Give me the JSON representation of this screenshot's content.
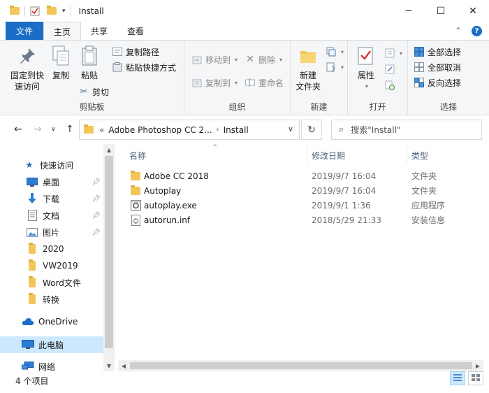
{
  "window": {
    "title": "Install",
    "minimize_glyph": "─",
    "maximize_glyph": "☐",
    "close_glyph": "✕"
  },
  "tabs": [
    {
      "label": "文件",
      "kind": "file"
    },
    {
      "label": "主页",
      "kind": "active"
    },
    {
      "label": "共享",
      "kind": ""
    },
    {
      "label": "查看",
      "kind": ""
    }
  ],
  "ribbon": {
    "clipboard": {
      "label": "剪贴板",
      "pin": "固定到快\n速访问",
      "copy": "复制",
      "paste": "粘贴",
      "copy_path": "复制路径",
      "paste_shortcut": "粘贴快捷方式",
      "cut": "剪切"
    },
    "organize": {
      "label": "组织",
      "move_to": "移动到",
      "copy_to": "复制到",
      "delete": "删除",
      "rename": "重命名"
    },
    "new": {
      "label": "新建",
      "new_folder": "新建\n文件夹"
    },
    "open": {
      "label": "打开",
      "properties": "属性"
    },
    "select": {
      "label": "选择",
      "select_all": "全部选择",
      "select_none": "全部取消",
      "invert": "反向选择"
    }
  },
  "address": {
    "prefix": "«",
    "segments": [
      "Adobe Photoshop CC 2...",
      "Install"
    ],
    "search_placeholder": "搜索\"Install\""
  },
  "nav": {
    "quick_access": "快速访问",
    "items": [
      {
        "label": "桌面",
        "icon": "desktop-icon",
        "pinned": true
      },
      {
        "label": "下载",
        "icon": "download-icon",
        "pinned": true
      },
      {
        "label": "文档",
        "icon": "document-icon",
        "pinned": true
      },
      {
        "label": "图片",
        "icon": "picture-icon",
        "pinned": true
      },
      {
        "label": "2020",
        "icon": "folder-icon",
        "pinned": false
      },
      {
        "label": "VW2019",
        "icon": "folder-icon",
        "pinned": false
      },
      {
        "label": "Word文件",
        "icon": "folder-icon",
        "pinned": false
      },
      {
        "label": "转换",
        "icon": "folder-icon",
        "pinned": false
      }
    ],
    "onedrive": "OneDrive",
    "this_pc": "此电脑",
    "network": "网络"
  },
  "list": {
    "columns": {
      "name": "名称",
      "modified": "修改日期",
      "type": "类型"
    },
    "files": [
      {
        "name": "Adobe CC 2018",
        "modified": "2019/9/7 16:04",
        "type": "文件夹",
        "icon": "folder-icon"
      },
      {
        "name": "Autoplay",
        "modified": "2019/9/7 16:04",
        "type": "文件夹",
        "icon": "folder-icon"
      },
      {
        "name": "autoplay.exe",
        "modified": "2019/9/1 1:36",
        "type": "应用程序",
        "icon": "exe-icon"
      },
      {
        "name": "autorun.inf",
        "modified": "2018/5/29 21:33",
        "type": "安装信息",
        "icon": "inf-icon"
      }
    ]
  },
  "status": {
    "item_count": "4 个项目"
  },
  "colors": {
    "accent": "#1a6ec6",
    "folder": "#f3c65a",
    "selection": "#cce8ff"
  }
}
